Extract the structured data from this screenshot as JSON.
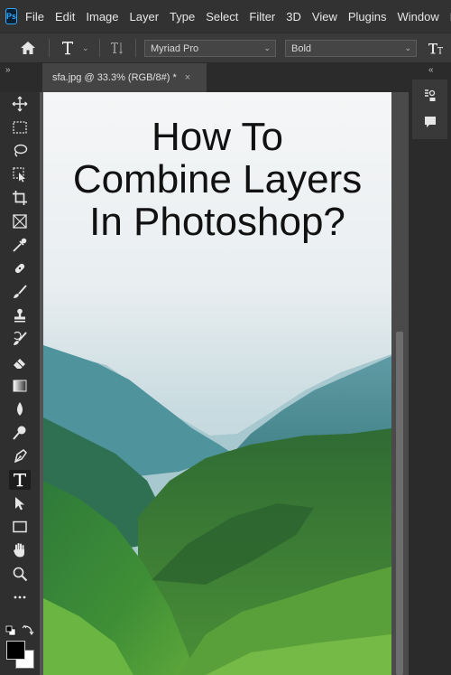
{
  "app": {
    "logo_text": "Ps"
  },
  "menu": {
    "items": [
      "File",
      "Edit",
      "Image",
      "Layer",
      "Type",
      "Select",
      "Filter",
      "3D",
      "View",
      "Plugins",
      "Window",
      "He"
    ]
  },
  "options_bar": {
    "font_family": "Myriad Pro",
    "font_style": "Bold",
    "chevron": "⌄",
    "icons": [
      "home-icon",
      "type-tool-preset-icon",
      "text-orientation-icon",
      "text-size-icon"
    ]
  },
  "panels": {
    "collapse_left": "»",
    "collapse_right": "«"
  },
  "document": {
    "tab_title": "sfa.jpg @ 33.3% (RGB/8#) *",
    "close_symbol": "×",
    "headline_lines": [
      "How To",
      "Combine Layers",
      "In Photoshop?"
    ]
  },
  "toolbar": {
    "tools": [
      "move-tool-icon",
      "marquee-tool-icon",
      "lasso-tool-icon",
      "object-selection-tool-icon",
      "crop-tool-icon",
      "frame-tool-icon",
      "eyedropper-tool-icon",
      "healing-brush-tool-icon",
      "brush-tool-icon",
      "clone-stamp-tool-icon",
      "history-brush-tool-icon",
      "eraser-tool-icon",
      "gradient-tool-icon",
      "blur-tool-icon",
      "dodge-tool-icon",
      "pen-tool-icon",
      "type-tool-icon",
      "path-selection-tool-icon",
      "rectangle-tool-icon",
      "hand-tool-icon",
      "zoom-tool-icon",
      "more-tools-icon"
    ],
    "active_tool": "type-tool-icon",
    "foreground_color": "#000000",
    "background_color": "#ffffff"
  },
  "colors": {
    "accent": "#31a8ff",
    "menubar": "#323232",
    "workspace": "#535353"
  },
  "dock": {
    "icons": [
      "properties-panel-icon",
      "comments-panel-icon"
    ]
  }
}
